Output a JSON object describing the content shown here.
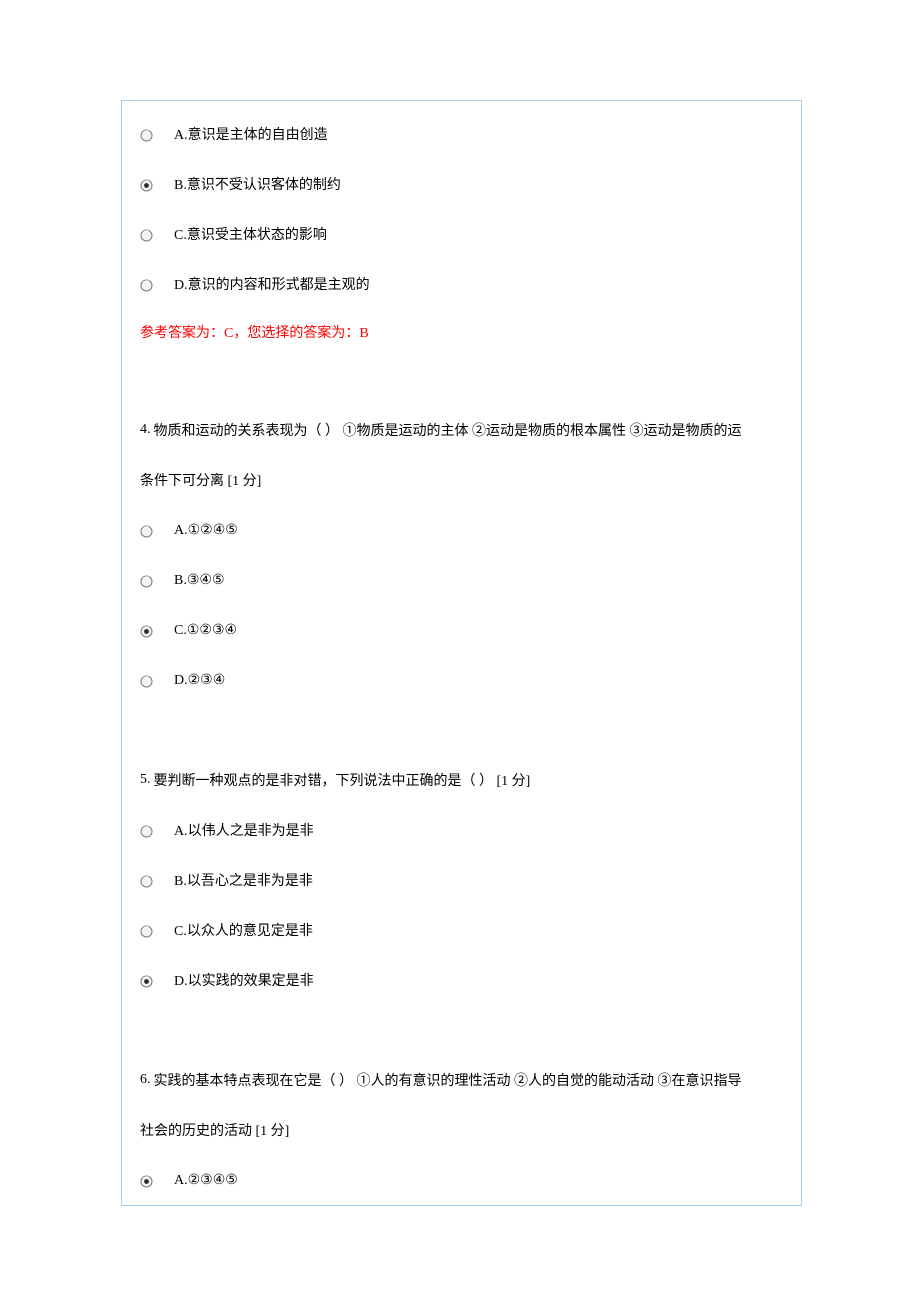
{
  "q3": {
    "options": [
      {
        "label": "A.意识是主体的自由创造",
        "selected": false
      },
      {
        "label": "B.意识不受认识客体的制约",
        "selected": true
      },
      {
        "label": "C.意识受主体状态的影响",
        "selected": false
      },
      {
        "label": "D.意识的内容和形式都是主观的",
        "selected": false
      }
    ],
    "answer_feedback": "参考答案为：C，您选择的答案为：B"
  },
  "q4": {
    "number": " 4. ",
    "stem_line1": "物质和运动的关系表现为（ ） ①物质是运动的主体 ②运动是物质的根本属性 ③运动是物质的运",
    "stem_line2": "条件下可分离  [1 分]",
    "options": [
      {
        "label": "A.①②④⑤",
        "selected": false
      },
      {
        "label": "B.③④⑤",
        "selected": false
      },
      {
        "label": "C.①②③④",
        "selected": true
      },
      {
        "label": "D.②③④",
        "selected": false
      }
    ]
  },
  "q5": {
    "number": " 5. ",
    "stem": "要判断一种观点的是非对错，下列说法中正确的是（ ） [1 分]",
    "options": [
      {
        "label": "A.以伟人之是非为是非",
        "selected": false
      },
      {
        "label": "B.以吾心之是非为是非",
        "selected": false
      },
      {
        "label": "C.以众人的意见定是非",
        "selected": false
      },
      {
        "label": "D.以实践的效果定是非",
        "selected": true
      }
    ]
  },
  "q6": {
    "number": " 6. ",
    "stem_line1": "实践的基本特点表现在它是（ ） ①人的有意识的理性活动 ②人的自觉的能动活动 ③在意识指导",
    "stem_line2": "社会的历史的活动  [1 分]",
    "options": [
      {
        "label": "A.②③④⑤",
        "selected": true
      }
    ]
  },
  "icons": {
    "radio_unselected": "radio-empty",
    "radio_selected": "radio-filled"
  }
}
